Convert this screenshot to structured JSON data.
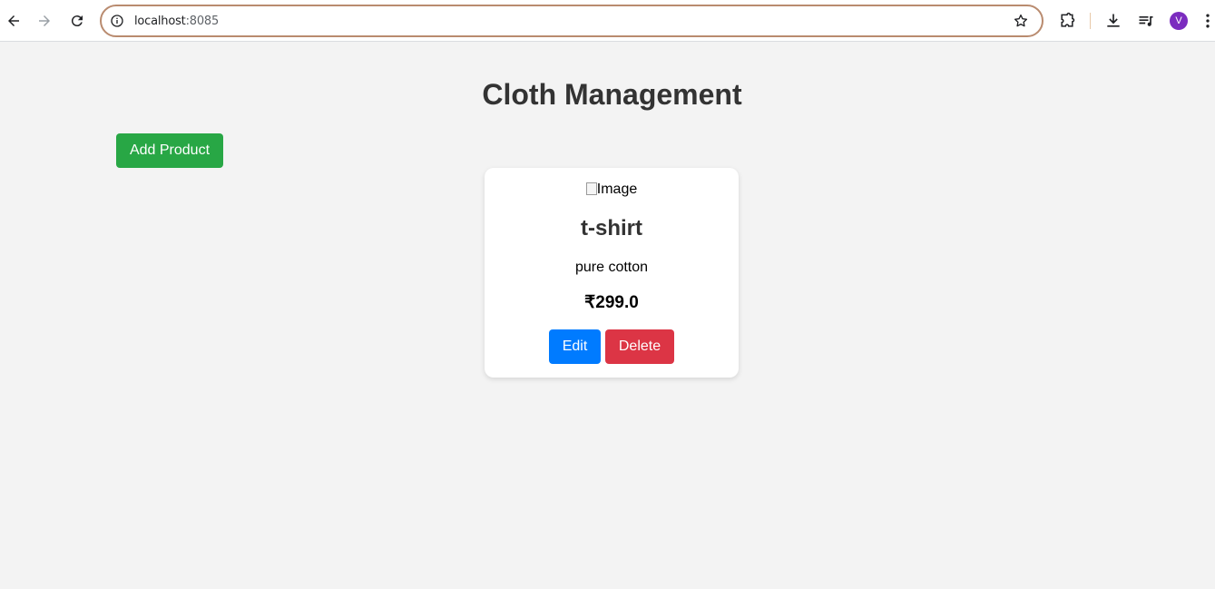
{
  "browser": {
    "url_host": "localhost",
    "url_port": ":8085",
    "profile_initial": "V"
  },
  "page": {
    "title": "Cloth Management",
    "add_button_label": "Add Product"
  },
  "products": [
    {
      "image_alt": "Image",
      "name": "t-shirt",
      "description": "pure cotton",
      "price": "₹299.0",
      "edit_label": "Edit",
      "delete_label": "Delete"
    }
  ],
  "colors": {
    "add_button": "#28a745",
    "edit_button": "#007bff",
    "delete_button": "#dc3545",
    "avatar": "#7b2cbf",
    "page_background": "#f3f3f3"
  }
}
